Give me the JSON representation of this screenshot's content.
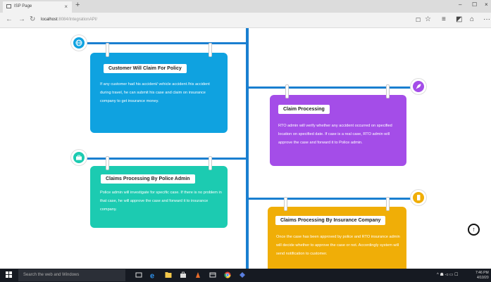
{
  "window": {
    "tab_title": "ISP Page",
    "tab_close": "×",
    "new_tab": "+",
    "minimize": "–",
    "maximize": "☐",
    "close": "×"
  },
  "address": {
    "back": "←",
    "forward": "→",
    "refresh": "↻",
    "url_host": "localhost",
    "url_path": ":8084/IntegrationAPI/"
  },
  "toolbar": {
    "reading": "☐",
    "favorite": "☆",
    "hub": "≡",
    "note": "◩",
    "share": "⌂",
    "more": "···"
  },
  "timeline": [
    {
      "icon": "globe-icon",
      "title": "Customer Will Claim For Policy",
      "text": "If any customer had his accident/ vehicle accident /his accident during travel, he can submit his case and claim on insurance company to get insurance money.",
      "color": "#0fa2e0"
    },
    {
      "icon": "rocket-icon",
      "title": "Claim Processing",
      "text": "RTO admin will verify whether any accident occurred on specified location on specified date. If case is a real case, RTO admin will approve the case and forward it to Police admin.",
      "color": "#a44de8"
    },
    {
      "icon": "briefcase-icon",
      "title": "Claims Processing By Police Admin",
      "text": "Police admin will investigate for specific case. If there is no problem in that case, he will approve the case and forward it to insurance company.",
      "color": "#1ccbb1"
    },
    {
      "icon": "mobile-icon",
      "title": "Claims Processing By Insurance Company",
      "text": "Once the case has been approved by police and RTO insurance admin will decide whether to approve the case or not. Accordingly system will send notification to customer.",
      "color": "#f0ae07"
    }
  ],
  "scroll_top": "↑",
  "taskbar": {
    "search_placeholder": "Search the web and Windows",
    "time": "7:46 PM",
    "date": "4/10/20"
  }
}
